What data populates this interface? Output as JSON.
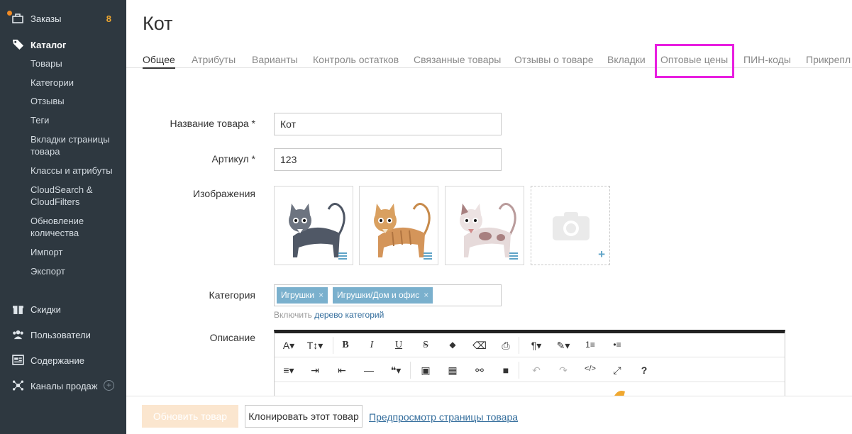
{
  "sidebar": {
    "orders": {
      "label": "Заказы",
      "count": "8"
    },
    "catalog": {
      "label": "Каталог",
      "items": [
        "Товары",
        "Категории",
        "Отзывы",
        "Теги",
        "Вкладки страницы товара",
        "Классы и атрибуты",
        "CloudSearch & CloudFilters",
        "Обновление количества",
        "Импорт",
        "Экспорт"
      ]
    },
    "discounts": "Скидки",
    "users": "Пользователи",
    "content": "Содержание",
    "channels": "Каналы продаж",
    "channels_add": "+"
  },
  "page": {
    "title": "Кот"
  },
  "tabs": [
    "Общее",
    "Атрибуты",
    "Варианты",
    "Контроль остатков",
    "Связанные товары",
    "Отзывы о товаре",
    "Вкладки",
    "Оптовые цены",
    "ПИН-коды",
    "Прикрепл"
  ],
  "form": {
    "name_label": "Название товара *",
    "name_value": "Кот",
    "sku_label": "Артикул *",
    "sku_value": "123",
    "images_label": "Изображения",
    "category_label": "Категория",
    "categories": [
      "Игрушки",
      "Игрушки/Дом и офис"
    ],
    "chip_remove": "×",
    "category_hint": "Включить",
    "category_tree_link": "дерево категорий",
    "description_label": "Описание",
    "image_add": "+"
  },
  "toolbar": {
    "row1": [
      "A▾",
      "T↕▾",
      "B",
      "I",
      "U",
      "S",
      "◆",
      "⌫",
      "⎙",
      "¶▾",
      "✎▾",
      "1≡",
      "•≡"
    ],
    "row2": [
      "≡▾",
      "⇥",
      "⇤",
      "—",
      "❝▾",
      "▣",
      "▦",
      "⚯",
      "■",
      "↶",
      "↷",
      "</>",
      "⤢",
      "?"
    ]
  },
  "footer": {
    "update_button": "Обновить товар",
    "clone_button": "Клонировать этот товар",
    "preview_link": "Предпросмотр страницы товара"
  },
  "colors": {
    "sidebar_bg": "#2e3840",
    "accent_orange": "#f0a830",
    "highlight": "#e81ee0",
    "chip": "#7ab0cd",
    "link": "#336d9c"
  }
}
